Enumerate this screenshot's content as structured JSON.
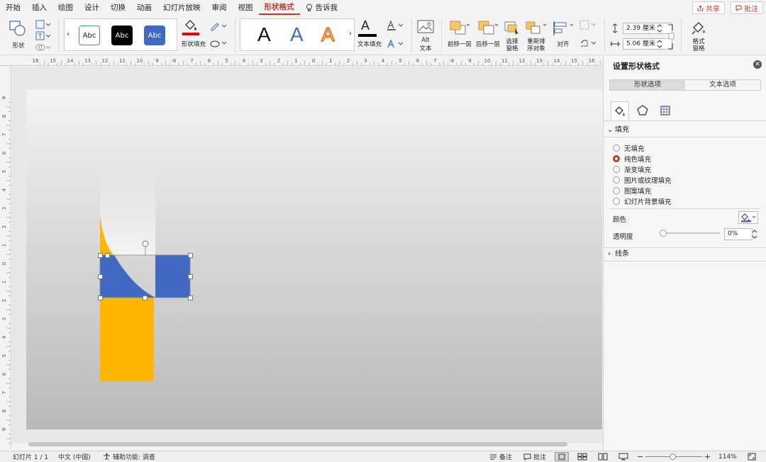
{
  "menu": {
    "items": [
      "开始",
      "插入",
      "绘图",
      "设计",
      "切换",
      "动画",
      "幻灯片放映",
      "审阅",
      "视图",
      "形状格式"
    ],
    "active_index": 9,
    "tell_me": "告诉我",
    "share": "共享",
    "comments": "批注"
  },
  "ribbon": {
    "shape_label": "形状",
    "style_samples": [
      "Abc",
      "Abc",
      "Abc"
    ],
    "shape_fill_label": "形状填充",
    "wordart_samples": [
      "A",
      "A",
      "A"
    ],
    "text_fill_label": "文本填充",
    "alt_text_line1": "Alt",
    "alt_text_line2": "文本",
    "bring_forward": "前移一层",
    "send_backward": "后移一层",
    "selection_pane_line1": "选择",
    "selection_pane_line2": "窗格",
    "reorder_line1": "重新排",
    "reorder_line2": "序对象",
    "align": "对齐",
    "height_value": "2.39 厘米",
    "width_value": "5.06 厘米",
    "format_pane_line1": "格式",
    "format_pane_line2": "窗格"
  },
  "ruler": {
    "h_labels": [
      "16",
      "15",
      "14",
      "13",
      "12",
      "11",
      "10",
      "9",
      "8",
      "7",
      "6",
      "5",
      "4",
      "3",
      "2",
      "1",
      "0",
      "1",
      "2",
      "3",
      "4",
      "5",
      "6",
      "7",
      "8",
      "9",
      "10",
      "11",
      "12",
      "13",
      "14",
      "15",
      "16"
    ],
    "v_labels": [
      "9",
      "8",
      "7",
      "6",
      "5",
      "4",
      "3",
      "2",
      "1",
      "0",
      "1",
      "2",
      "3",
      "4",
      "5",
      "6",
      "7",
      "8",
      "9"
    ]
  },
  "panel": {
    "title": "设置形状格式",
    "tabs": [
      "形状选项",
      "文本选项"
    ],
    "fill_section": "填充",
    "fill_options": [
      "无填充",
      "纯色填充",
      "渐变填充",
      "图片或纹理填充",
      "图案填充",
      "幻灯片背景填充"
    ],
    "selected_fill_index": 1,
    "color_label": "颜色",
    "transparency_label": "透明度",
    "transparency_value": "0%",
    "line_section": "线条"
  },
  "status": {
    "slide": "幻灯片 1 / 1",
    "language": "中文 (中国)",
    "accessibility": "辅助功能: 调查",
    "notes": "备注",
    "comments": "批注",
    "zoom": "114%"
  },
  "colors": {
    "accent_red": "#c0392b",
    "shape_blue": "#4169c1",
    "shape_yellow": "#ffb600"
  }
}
